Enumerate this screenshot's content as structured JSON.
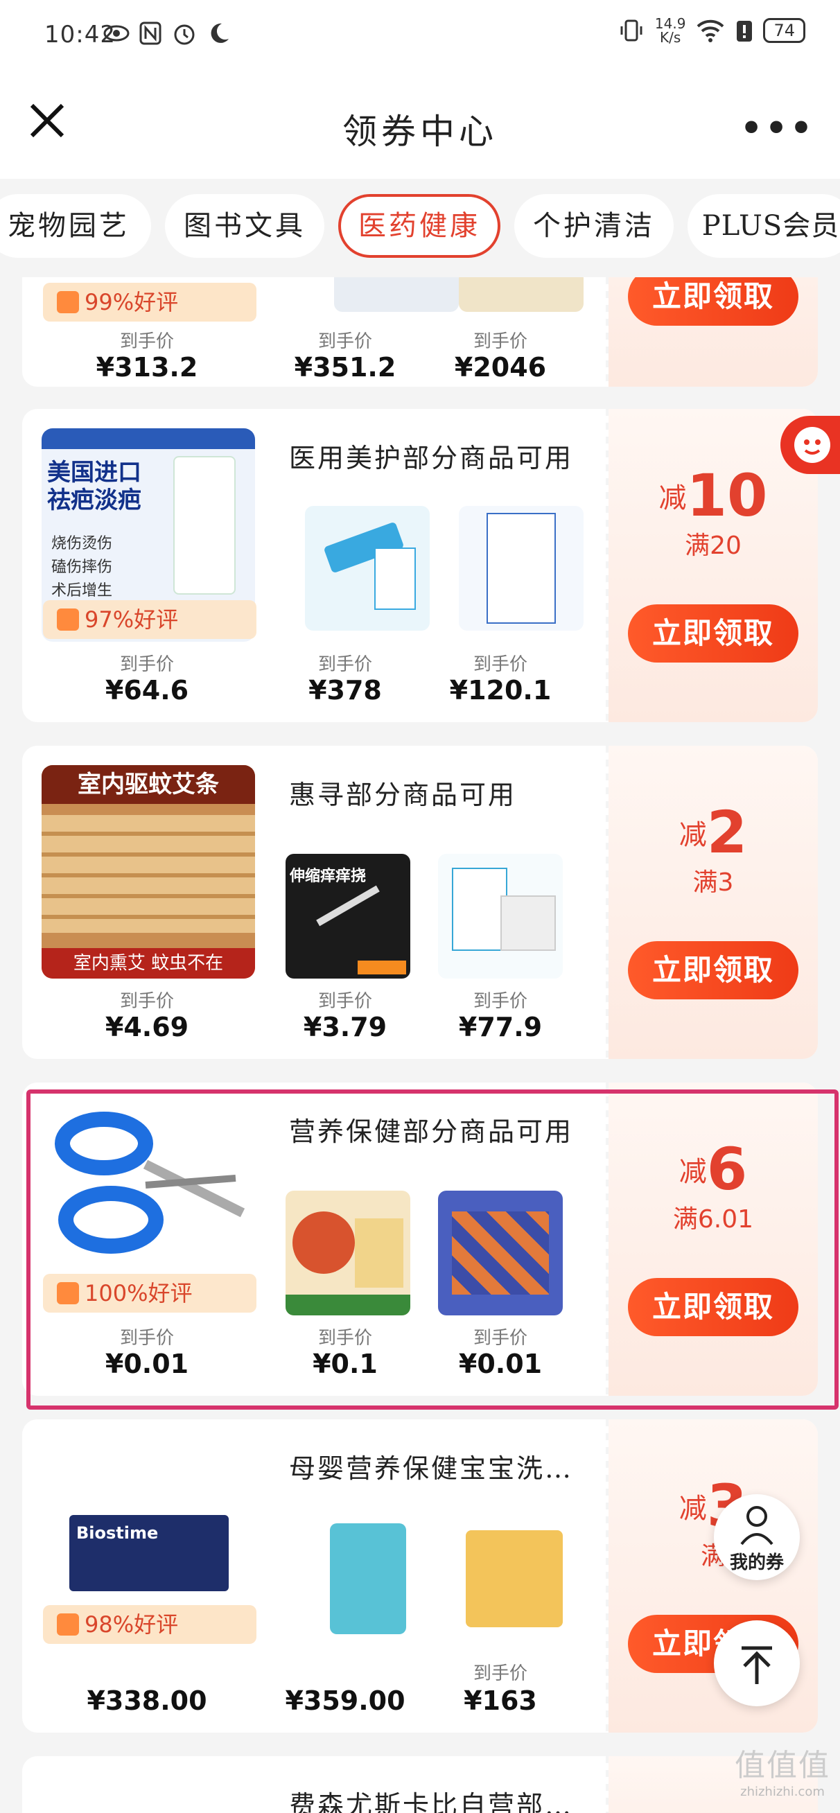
{
  "status_bar": {
    "time": "10:42",
    "speed_value": "14.9",
    "speed_unit": "K/s",
    "battery": "74"
  },
  "header": {
    "title": "领券中心",
    "more": "•••"
  },
  "tabs": [
    {
      "label": "宠物园艺"
    },
    {
      "label": "图书文具"
    },
    {
      "label": "医药健康",
      "active": true
    },
    {
      "label": "个护清洁"
    },
    {
      "label": "PLUS会员"
    }
  ],
  "price_label": "到手价",
  "claim_label": "立即领取",
  "cards": [
    {
      "rating": "99%好评",
      "prices": [
        "¥313.2",
        "¥351.2",
        "¥2046"
      ]
    },
    {
      "desc": "医用美护部分商品可用",
      "discount": "10",
      "threshold": "满20",
      "rating": "97%好评",
      "main_img_text": [
        "美国进口",
        "祛疤淡疤",
        "烧伤烫伤",
        "磕伤摔伤",
        "术后增生"
      ],
      "prices": [
        "¥64.6",
        "¥378",
        "¥120.1"
      ]
    },
    {
      "desc": "惠寻部分商品可用",
      "discount": "2",
      "threshold": "满3",
      "main_img_text": [
        "室内驱蚊艾条",
        "室内熏艾 蚊虫不在"
      ],
      "sub_img_text": "伸缩痒痒挠",
      "prices": [
        "¥4.69",
        "¥3.79",
        "¥77.9"
      ]
    },
    {
      "desc": "营养保健部分商品可用",
      "discount": "6",
      "threshold": "满6.01",
      "rating": "100%好评",
      "prices": [
        "¥0.01",
        "¥0.1",
        "¥0.01"
      ]
    },
    {
      "desc": "母婴营养保健宝宝洗…",
      "discount": "3",
      "threshold": "满",
      "rating": "98%好评",
      "brand": "Biostime",
      "prices": [
        "¥338.00",
        "¥359.00",
        "¥163"
      ]
    },
    {
      "desc": "费森尤斯卡比自营部…"
    }
  ],
  "jian": "减",
  "float": {
    "my_coupons": "我的券"
  },
  "watermark": {
    "big": "值值值",
    "small": "zhizhizhi.com"
  }
}
